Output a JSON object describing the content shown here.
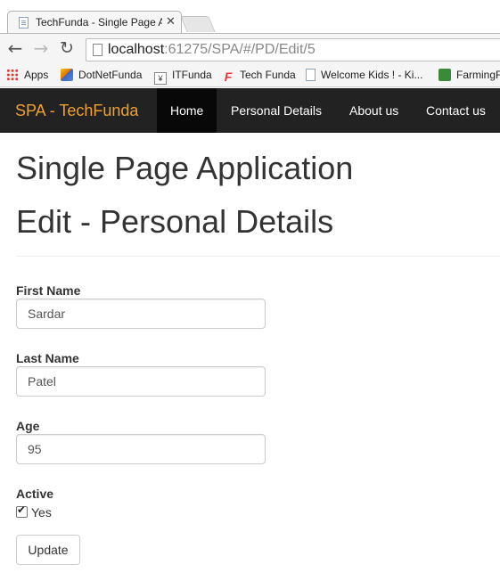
{
  "browser": {
    "tab_title": "TechFunda - Single Page Application",
    "tab_close_icon": "close-icon",
    "url_host": "localhost",
    "url_rest": ":61275/SPA/#/PD/Edit/5",
    "bookmarks": [
      "Apps",
      "DotNetFunda",
      "ITFunda",
      "Tech Funda",
      "Welcome Kids ! - Ki...",
      "FarmingF"
    ]
  },
  "navbar": {
    "brand": "SPA - TechFunda",
    "items": [
      "Home",
      "Personal Details",
      "About us",
      "Contact us"
    ],
    "active": "Home"
  },
  "page": {
    "app_title": "Single Page Application",
    "heading": "Edit - Personal Details"
  },
  "form": {
    "first_name_label": "First Name",
    "first_name_value": "Sardar",
    "last_name_label": "Last Name",
    "last_name_value": "Patel",
    "age_label": "Age",
    "age_value": "95",
    "active_label": "Active",
    "active_checked": true,
    "active_option": "Yes",
    "submit_label": "Update"
  },
  "colors": {
    "navbar_bg": "#222222",
    "brand_color": "#f0a030",
    "active_nav_bg": "#080808"
  }
}
